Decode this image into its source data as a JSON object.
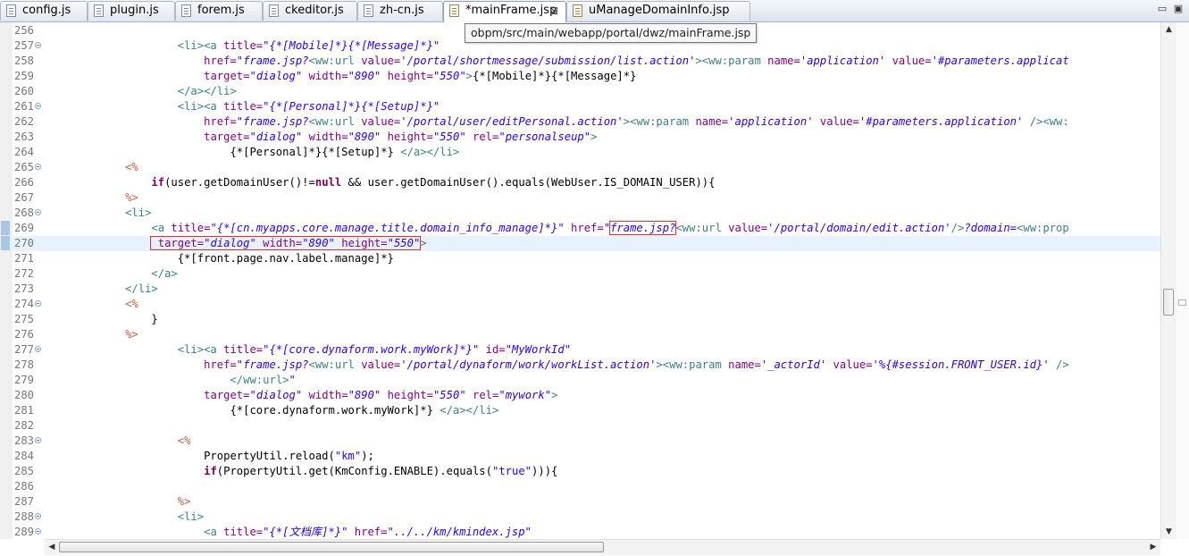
{
  "tabs": [
    {
      "label": "config.js",
      "icon": "js-file-icon"
    },
    {
      "label": "plugin.js",
      "icon": "js-file-icon"
    },
    {
      "label": "forem.js",
      "icon": "js-file-icon"
    },
    {
      "label": "ckeditor.js",
      "icon": "js-file-icon"
    },
    {
      "label": "zh-cn.js",
      "icon": "js-file-icon"
    },
    {
      "label": "*mainFrame.jsp",
      "icon": "jsp-file-icon",
      "active": true,
      "close": "⊠"
    },
    {
      "label": "uManageDomainInfo.jsp",
      "icon": "jsp-file-icon"
    }
  ],
  "window_controls": {
    "minimize": "▭",
    "maximize": "▣"
  },
  "tooltip": "obpm/src/main/webapp/portal/dwz/mainFrame.jsp",
  "editor": {
    "current_line": 270,
    "lines": [
      {
        "n": "256",
        "seg": []
      },
      {
        "n": "257",
        "fold": true,
        "seg": [
          [
            "p",
            "                    "
          ],
          [
            "tag",
            "<li><a "
          ],
          [
            "attr",
            "title="
          ],
          [
            "val",
            "\"{*[Mobile]*}{*[Message]*}\""
          ]
        ]
      },
      {
        "n": "258",
        "seg": [
          [
            "p",
            "                        "
          ],
          [
            "attr",
            "href="
          ],
          [
            "val",
            "\"frame.jsp?"
          ],
          [
            "tag",
            "<ww:url "
          ],
          [
            "attr",
            "value="
          ],
          [
            "val",
            "'/portal/shortmessage/submission/list.action'"
          ],
          [
            "tag",
            ">"
          ],
          [
            "tag",
            "<ww:param "
          ],
          [
            "attr",
            "name="
          ],
          [
            "val",
            "'application'"
          ],
          [
            "p",
            " "
          ],
          [
            "attr",
            "value="
          ],
          [
            "val",
            "'#parameters.applicat"
          ]
        ]
      },
      {
        "n": "259",
        "seg": [
          [
            "p",
            "                        "
          ],
          [
            "attr",
            "target="
          ],
          [
            "val",
            "\"dialog\""
          ],
          [
            "p",
            " "
          ],
          [
            "attr",
            "width="
          ],
          [
            "val",
            "\"890\""
          ],
          [
            "p",
            " "
          ],
          [
            "attr",
            "height="
          ],
          [
            "val",
            "\"550\""
          ],
          [
            "tag",
            ">"
          ],
          [
            "p",
            "{*[Mobile]*}{*[Message]*}"
          ]
        ]
      },
      {
        "n": "260",
        "seg": [
          [
            "p",
            "                    "
          ],
          [
            "tag",
            "</a></li>"
          ]
        ]
      },
      {
        "n": "261",
        "fold": true,
        "seg": [
          [
            "p",
            "                    "
          ],
          [
            "tag",
            "<li><a "
          ],
          [
            "attr",
            "title="
          ],
          [
            "val",
            "\"{*[Personal]*}{*[Setup]*}\""
          ]
        ]
      },
      {
        "n": "262",
        "seg": [
          [
            "p",
            "                        "
          ],
          [
            "attr",
            "href="
          ],
          [
            "val",
            "\"frame.jsp?"
          ],
          [
            "tag",
            "<ww:url "
          ],
          [
            "attr",
            "value="
          ],
          [
            "val",
            "'/portal/user/editPersonal.action'"
          ],
          [
            "tag",
            ">"
          ],
          [
            "tag",
            "<ww:param "
          ],
          [
            "attr",
            "name="
          ],
          [
            "val",
            "'application'"
          ],
          [
            "p",
            " "
          ],
          [
            "attr",
            "value="
          ],
          [
            "val",
            "'#parameters.application'"
          ],
          [
            "p",
            " "
          ],
          [
            "tag",
            "/><ww:"
          ]
        ]
      },
      {
        "n": "263",
        "seg": [
          [
            "p",
            "                        "
          ],
          [
            "attr",
            "target="
          ],
          [
            "val",
            "\"dialog\""
          ],
          [
            "p",
            " "
          ],
          [
            "attr",
            "width="
          ],
          [
            "val",
            "\"890\""
          ],
          [
            "p",
            " "
          ],
          [
            "attr",
            "height="
          ],
          [
            "val",
            "\"550\""
          ],
          [
            "p",
            " "
          ],
          [
            "attr",
            "rel="
          ],
          [
            "val",
            "\"personalseup\""
          ],
          [
            "tag",
            ">"
          ]
        ]
      },
      {
        "n": "264",
        "seg": [
          [
            "p",
            "                            {*[Personal]*}{*[Setup]*} "
          ],
          [
            "tag",
            "</a></li>"
          ]
        ]
      },
      {
        "n": "265",
        "fold": true,
        "seg": [
          [
            "p",
            "            "
          ],
          [
            "sc",
            "<%"
          ]
        ]
      },
      {
        "n": "266",
        "seg": [
          [
            "p",
            "                "
          ],
          [
            "kw",
            "if"
          ],
          [
            "p",
            "(user.getDomainUser()!="
          ],
          [
            "kw",
            "null"
          ],
          [
            "p",
            " && user.getDomainUser().equals(WebUser.IS_DOMAIN_USER)){"
          ]
        ]
      },
      {
        "n": "267",
        "seg": [
          [
            "p",
            "            "
          ],
          [
            "sc",
            "%>"
          ]
        ]
      },
      {
        "n": "268",
        "fold": true,
        "seg": [
          [
            "p",
            "            "
          ],
          [
            "tag",
            "<li>"
          ]
        ]
      },
      {
        "n": "269",
        "mark": true,
        "seg": [
          [
            "p",
            "                "
          ],
          [
            "tag",
            "<a "
          ],
          [
            "attr",
            "title="
          ],
          [
            "val",
            "\"{*[cn.myapps.core.manage.title.domain_info_manage]*}\""
          ],
          [
            "p",
            " "
          ],
          [
            "attr",
            "href="
          ],
          [
            "val",
            "\""
          ],
          [
            "valbox",
            "frame.jsp?"
          ],
          [
            "tag",
            "<ww:url "
          ],
          [
            "attr",
            "value="
          ],
          [
            "val",
            "'/portal/domain/edit.action'"
          ],
          [
            "tag",
            "/>"
          ],
          [
            "val",
            "?domain="
          ],
          [
            "tag",
            "<ww:prop"
          ]
        ]
      },
      {
        "n": "270",
        "mark": true,
        "seg": [
          [
            "p",
            "                "
          ],
          [
            "boxstart",
            " "
          ],
          [
            "attr",
            "target="
          ],
          [
            "val",
            "\"dialog\""
          ],
          [
            "p",
            " "
          ],
          [
            "attr",
            "width="
          ],
          [
            "val",
            "\"890\""
          ],
          [
            "p",
            " "
          ],
          [
            "attr",
            "height="
          ],
          [
            "val",
            "\"550\""
          ],
          [
            "boxend",
            ""
          ],
          [
            "tag",
            ">"
          ]
        ]
      },
      {
        "n": "271",
        "seg": [
          [
            "p",
            "                    {*[front.page.nav.label.manage]*}"
          ]
        ]
      },
      {
        "n": "272",
        "seg": [
          [
            "p",
            "                "
          ],
          [
            "tag",
            "</a>"
          ]
        ]
      },
      {
        "n": "273",
        "seg": [
          [
            "p",
            "            "
          ],
          [
            "tag",
            "</li>"
          ]
        ]
      },
      {
        "n": "274",
        "fold": true,
        "seg": [
          [
            "p",
            "            "
          ],
          [
            "sc",
            "<%"
          ]
        ]
      },
      {
        "n": "275",
        "seg": [
          [
            "p",
            "                }"
          ]
        ]
      },
      {
        "n": "276",
        "seg": [
          [
            "p",
            "            "
          ],
          [
            "sc",
            "%>"
          ]
        ]
      },
      {
        "n": "277",
        "fold": true,
        "seg": [
          [
            "p",
            "                    "
          ],
          [
            "tag",
            "<li><a "
          ],
          [
            "attr",
            "title="
          ],
          [
            "val",
            "\"{*[core.dynaform.work.myWork]*}\""
          ],
          [
            "p",
            " "
          ],
          [
            "attr",
            "id="
          ],
          [
            "val",
            "\"MyWorkId\""
          ]
        ]
      },
      {
        "n": "278",
        "seg": [
          [
            "p",
            "                        "
          ],
          [
            "attr",
            "href="
          ],
          [
            "val",
            "\"frame.jsp?"
          ],
          [
            "tag",
            "<ww:url "
          ],
          [
            "attr",
            "value="
          ],
          [
            "val",
            "'/portal/dynaform/work/workList.action'"
          ],
          [
            "tag",
            ">"
          ],
          [
            "tag",
            "<ww:param "
          ],
          [
            "attr",
            "name="
          ],
          [
            "val",
            "'_actorId'"
          ],
          [
            "p",
            " "
          ],
          [
            "attr",
            "value="
          ],
          [
            "val",
            "'%{#session.FRONT_USER.id}'"
          ],
          [
            "p",
            " "
          ],
          [
            "tag",
            "/>"
          ]
        ]
      },
      {
        "n": "279",
        "seg": [
          [
            "p",
            "                            "
          ],
          [
            "tag",
            "</ww:url>"
          ],
          [
            "val",
            "\""
          ]
        ]
      },
      {
        "n": "280",
        "seg": [
          [
            "p",
            "                        "
          ],
          [
            "attr",
            "target="
          ],
          [
            "val",
            "\"dialog\""
          ],
          [
            "p",
            " "
          ],
          [
            "attr",
            "width="
          ],
          [
            "val",
            "\"890\""
          ],
          [
            "p",
            " "
          ],
          [
            "attr",
            "height="
          ],
          [
            "val",
            "\"550\""
          ],
          [
            "p",
            " "
          ],
          [
            "attr",
            "rel="
          ],
          [
            "val",
            "\"mywork\""
          ],
          [
            "tag",
            ">"
          ]
        ]
      },
      {
        "n": "281",
        "seg": [
          [
            "p",
            "                            {*[core.dynaform.work.myWork]*} "
          ],
          [
            "tag",
            "</a></li>"
          ]
        ]
      },
      {
        "n": "282",
        "seg": []
      },
      {
        "n": "283",
        "fold": true,
        "seg": [
          [
            "p",
            "                    "
          ],
          [
            "sc",
            "<%"
          ]
        ]
      },
      {
        "n": "284",
        "seg": [
          [
            "p",
            "                        PropertyUtil.reload("
          ],
          [
            "str",
            "\"km\""
          ],
          [
            "p",
            ");"
          ]
        ]
      },
      {
        "n": "285",
        "seg": [
          [
            "p",
            "                        "
          ],
          [
            "kw",
            "if"
          ],
          [
            "p",
            "(PropertyUtil.get(KmConfig.ENABLE).equals("
          ],
          [
            "str",
            "\"true\""
          ],
          [
            "p",
            "))){"
          ]
        ]
      },
      {
        "n": "286",
        "seg": []
      },
      {
        "n": "287",
        "seg": [
          [
            "p",
            "                    "
          ],
          [
            "sc",
            "%>"
          ]
        ]
      },
      {
        "n": "288",
        "fold": true,
        "seg": [
          [
            "p",
            "                    "
          ],
          [
            "tag",
            "<li>"
          ]
        ]
      },
      {
        "n": "289",
        "fold": true,
        "seg": [
          [
            "p",
            "                        "
          ],
          [
            "tag",
            "<a "
          ],
          [
            "attr",
            "title="
          ],
          [
            "val",
            "\"{*[文档库]*}\""
          ],
          [
            "p",
            " "
          ],
          [
            "attr",
            "href="
          ],
          [
            "val",
            "\"../../km/kmindex.jsp\""
          ]
        ]
      }
    ]
  }
}
